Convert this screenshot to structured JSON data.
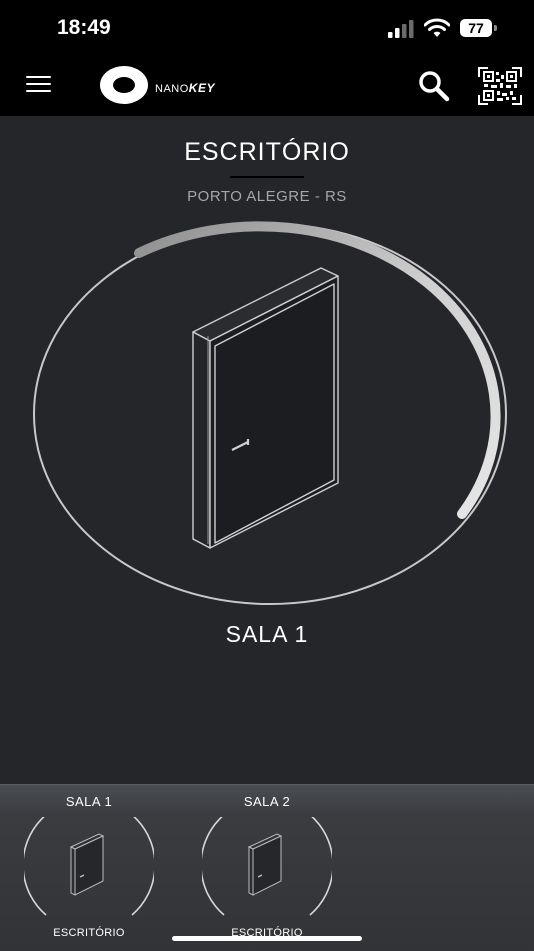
{
  "status_bar": {
    "time": "18:49",
    "battery": "77"
  },
  "header": {
    "logo_prefix": "NANO",
    "logo_suffix": "KEY",
    "icons": [
      "menu-icon",
      "search-icon",
      "qr-code-icon"
    ]
  },
  "place": {
    "title": "ESCRITÓRIO",
    "location": "PORTO ALEGRE - RS"
  },
  "selected_lock": {
    "name": "SALA 1",
    "icon": "door-icon"
  },
  "locks": [
    {
      "name": "SALA 1",
      "place": "ESCRITÓRIO",
      "icon": "door-icon"
    },
    {
      "name": "SALA 2",
      "place": "ESCRITÓRIO",
      "icon": "door-icon"
    }
  ],
  "colors": {
    "background": "#24262a",
    "header": "#000000",
    "accent": "#ffffff",
    "muted_text": "#a6a6a6",
    "tray": "#3a3c40"
  }
}
